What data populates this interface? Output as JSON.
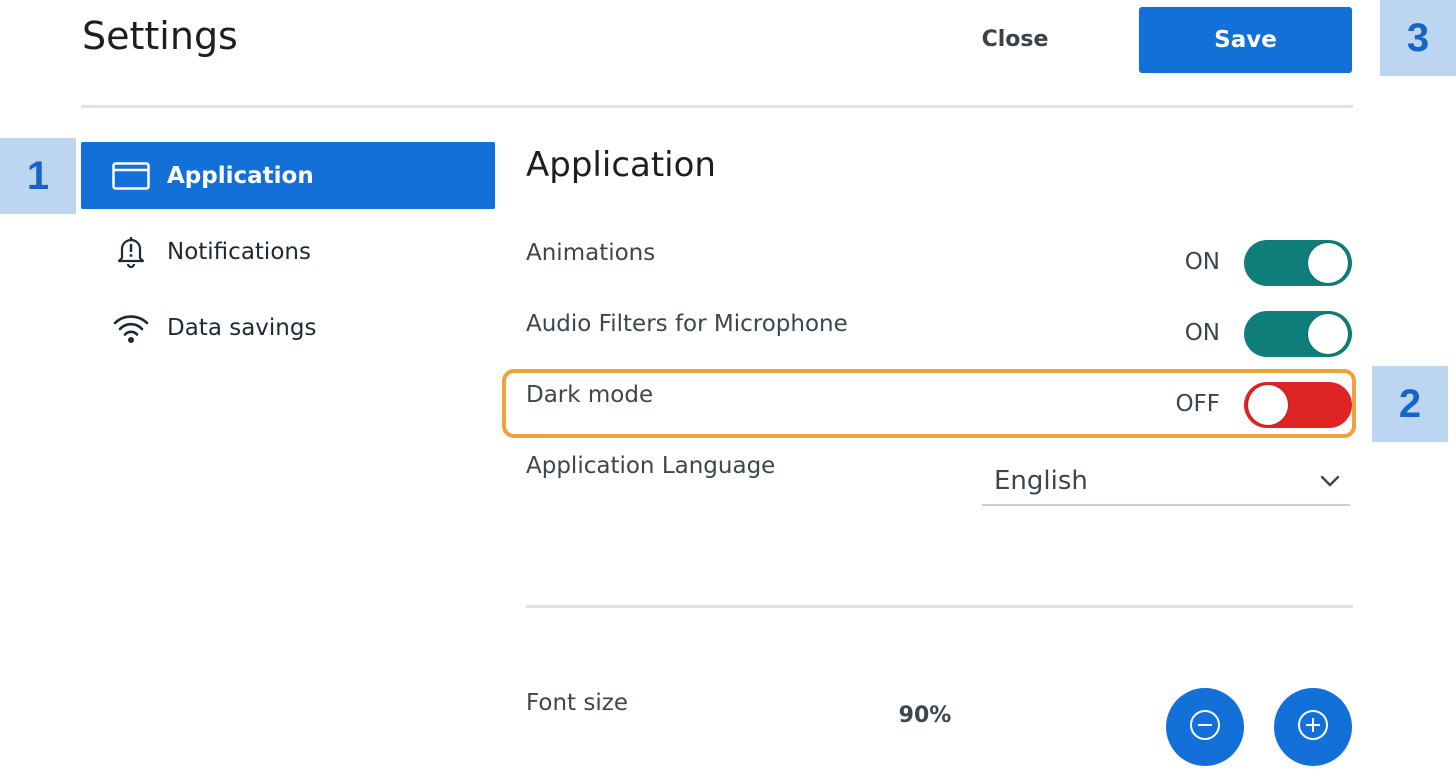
{
  "header": {
    "title": "Settings",
    "close_label": "Close",
    "save_label": "Save"
  },
  "badges": [
    "1",
    "2",
    "3"
  ],
  "sidebar": {
    "items": [
      {
        "label": "Application",
        "icon": "browser-window-icon",
        "active": true
      },
      {
        "label": "Notifications",
        "icon": "bell-alert-icon",
        "active": false
      },
      {
        "label": "Data savings",
        "icon": "wifi-icon",
        "active": false
      }
    ]
  },
  "main": {
    "section_title": "Application",
    "toggles": [
      {
        "label": "Animations",
        "state": "ON"
      },
      {
        "label": "Audio Filters for Microphone",
        "state": "ON"
      },
      {
        "label": "Dark mode",
        "state": "OFF"
      }
    ],
    "language": {
      "label": "Application Language",
      "value": "English"
    },
    "font_size": {
      "label": "Font size",
      "value": "90%"
    }
  },
  "colors": {
    "primary": "#1270d8",
    "toggle_on": "#0f7e7a",
    "toggle_off": "#df2524",
    "highlight": "#f0a03d",
    "badge_bg": "#bcd6f2",
    "badge_text": "#1565c5"
  }
}
